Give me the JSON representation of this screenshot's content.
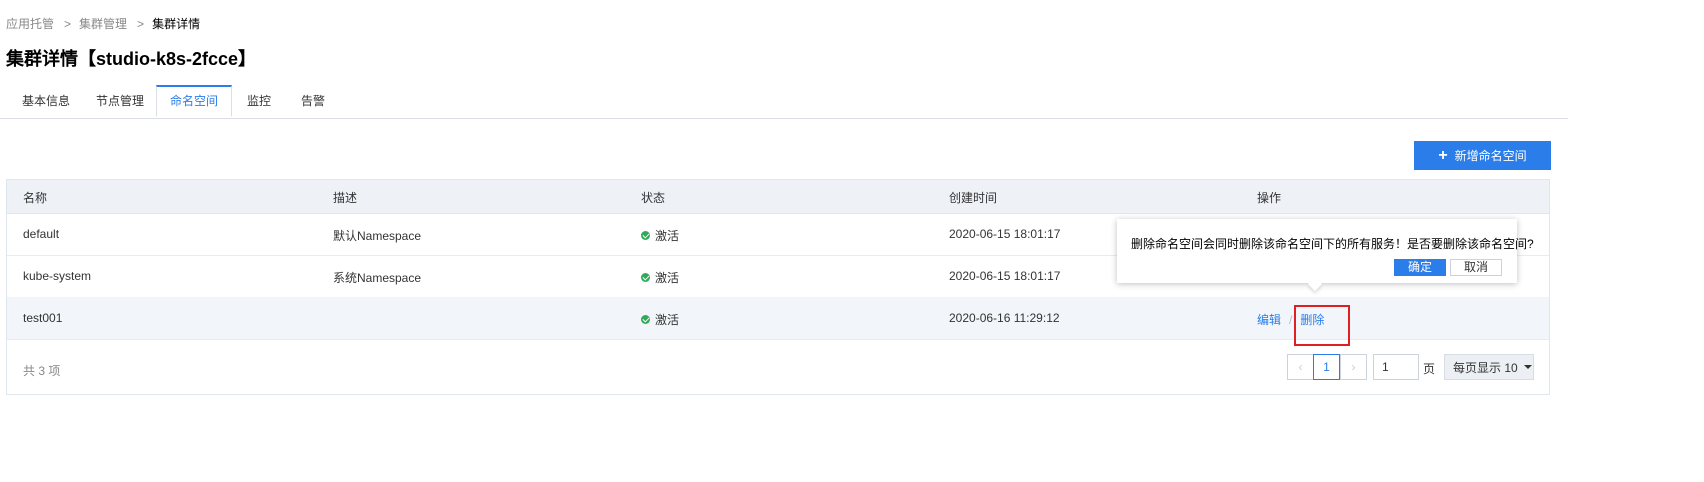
{
  "breadcrumb": {
    "items": [
      "应用托管",
      "集群管理",
      "集群详情"
    ],
    "separator": ">"
  },
  "page": {
    "title": "集群详情【studio-k8s-2fcce】"
  },
  "tabs": [
    {
      "label": "基本信息",
      "active": false
    },
    {
      "label": "节点管理",
      "active": false
    },
    {
      "label": "命名空间",
      "active": true
    },
    {
      "label": "监控",
      "active": false
    },
    {
      "label": "告警",
      "active": false
    }
  ],
  "toolbar": {
    "add_label": "新增命名空间"
  },
  "table": {
    "columns": [
      "名称",
      "描述",
      "状态",
      "创建时间",
      "操作"
    ],
    "rows": [
      {
        "name": "default",
        "description": "默认Namespace",
        "status": "激活",
        "created": "2020-06-15 18:01:17"
      },
      {
        "name": "kube-system",
        "description": "系统Namespace",
        "status": "激活",
        "created": "2020-06-15 18:01:17"
      },
      {
        "name": "test001",
        "description": "",
        "status": "激活",
        "created": "2020-06-16 11:29:12",
        "actions": {
          "edit": "编辑",
          "sep": "/",
          "delete": "删除"
        }
      }
    ]
  },
  "footer": {
    "total": "共 3 项",
    "pager": {
      "prev": "‹",
      "current": "1",
      "next": "›",
      "input_value": "1",
      "unit": "页",
      "page_size": "每页显示 10"
    }
  },
  "popconfirm": {
    "message": "删除命名空间会同时删除该命名空间下的所有服务！是否要删除该命名空间?",
    "ok": "确定",
    "cancel": "取消"
  },
  "colors": {
    "accent": "#2b7de9",
    "status_active": "#2dab58",
    "highlight": "#e02020"
  }
}
